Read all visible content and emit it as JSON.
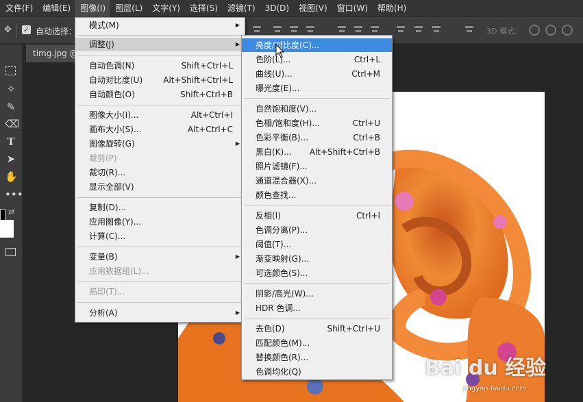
{
  "menubar": {
    "items": [
      "文件(F)",
      "编辑(E)",
      "图像(I)",
      "图层(L)",
      "文字(Y)",
      "选择(S)",
      "滤镜(T)",
      "3D(D)",
      "视图(V)",
      "窗口(W)",
      "帮助(H)"
    ],
    "active": "图像(I)"
  },
  "options": {
    "auto_select_label": "自动选择：",
    "auto_select_checked": true,
    "mode_3d_label": "3D 模式："
  },
  "document": {
    "tab_title": "timg.jpg @"
  },
  "image_menu": {
    "items": [
      {
        "label": "模式(M)",
        "shortcut": "",
        "submenu": true,
        "disabled": false
      },
      {
        "label": "调整(J)",
        "shortcut": "",
        "submenu": true,
        "disabled": false,
        "open": true
      },
      {
        "label": "自动色调(N)",
        "shortcut": "Shift+Ctrl+L",
        "submenu": false,
        "disabled": false
      },
      {
        "label": "自动对比度(U)",
        "shortcut": "Alt+Shift+Ctrl+L",
        "submenu": false,
        "disabled": false
      },
      {
        "label": "自动颜色(O)",
        "shortcut": "Shift+Ctrl+B",
        "submenu": false,
        "disabled": false
      },
      {
        "label": "图像大小(I)...",
        "shortcut": "Alt+Ctrl+I",
        "submenu": false,
        "disabled": false
      },
      {
        "label": "画布大小(S)...",
        "shortcut": "Alt+Ctrl+C",
        "submenu": false,
        "disabled": false
      },
      {
        "label": "图像旋转(G)",
        "shortcut": "",
        "submenu": true,
        "disabled": false
      },
      {
        "label": "裁剪(P)",
        "shortcut": "",
        "submenu": false,
        "disabled": true
      },
      {
        "label": "裁切(R)...",
        "shortcut": "",
        "submenu": false,
        "disabled": false
      },
      {
        "label": "显示全部(V)",
        "shortcut": "",
        "submenu": false,
        "disabled": false
      },
      {
        "label": "复制(D)...",
        "shortcut": "",
        "submenu": false,
        "disabled": false
      },
      {
        "label": "应用图像(Y)...",
        "shortcut": "",
        "submenu": false,
        "disabled": false
      },
      {
        "label": "计算(C)...",
        "shortcut": "",
        "submenu": false,
        "disabled": false
      },
      {
        "label": "变量(B)",
        "shortcut": "",
        "submenu": true,
        "disabled": false
      },
      {
        "label": "应用数据组(L)...",
        "shortcut": "",
        "submenu": false,
        "disabled": true
      },
      {
        "label": "陷印(T)...",
        "shortcut": "",
        "submenu": false,
        "disabled": true
      },
      {
        "label": "分析(A)",
        "shortcut": "",
        "submenu": true,
        "disabled": false
      }
    ]
  },
  "adjust_menu": {
    "items": [
      {
        "label": "亮度/对比度(C)...",
        "shortcut": "",
        "highlight": true
      },
      {
        "label": "色阶(L)...",
        "shortcut": "Ctrl+L"
      },
      {
        "label": "曲线(U)...",
        "shortcut": "Ctrl+M"
      },
      {
        "label": "曝光度(E)...",
        "shortcut": ""
      },
      {
        "label": "自然饱和度(V)...",
        "shortcut": ""
      },
      {
        "label": "色相/饱和度(H)...",
        "shortcut": "Ctrl+U"
      },
      {
        "label": "色彩平衡(B)...",
        "shortcut": "Ctrl+B"
      },
      {
        "label": "黑白(K)...",
        "shortcut": "Alt+Shift+Ctrl+B"
      },
      {
        "label": "照片滤镜(F)...",
        "shortcut": ""
      },
      {
        "label": "通道混合器(X)...",
        "shortcut": ""
      },
      {
        "label": "颜色查找...",
        "shortcut": ""
      },
      {
        "label": "反相(I)",
        "shortcut": "Ctrl+I"
      },
      {
        "label": "色调分离(P)...",
        "shortcut": ""
      },
      {
        "label": "阈值(T)...",
        "shortcut": ""
      },
      {
        "label": "渐变映射(G)...",
        "shortcut": ""
      },
      {
        "label": "可选颜色(S)...",
        "shortcut": ""
      },
      {
        "label": "阴影/高光(W)...",
        "shortcut": ""
      },
      {
        "label": "HDR 色调...",
        "shortcut": ""
      },
      {
        "label": "去色(D)",
        "shortcut": "Shift+Ctrl+U"
      },
      {
        "label": "匹配颜色(M)...",
        "shortcut": ""
      },
      {
        "label": "替换颜色(R)...",
        "shortcut": ""
      },
      {
        "label": "色调均化(Q)",
        "shortcut": ""
      }
    ]
  },
  "watermark": {
    "text": "Bai du 经验",
    "sub": "jingyan.baidu.com"
  },
  "colors": {
    "highlight": "#3d8be0",
    "menu_bg": "#efefef",
    "scarf_orange": "#e8731f",
    "scarf_pink": "#e879b4"
  }
}
